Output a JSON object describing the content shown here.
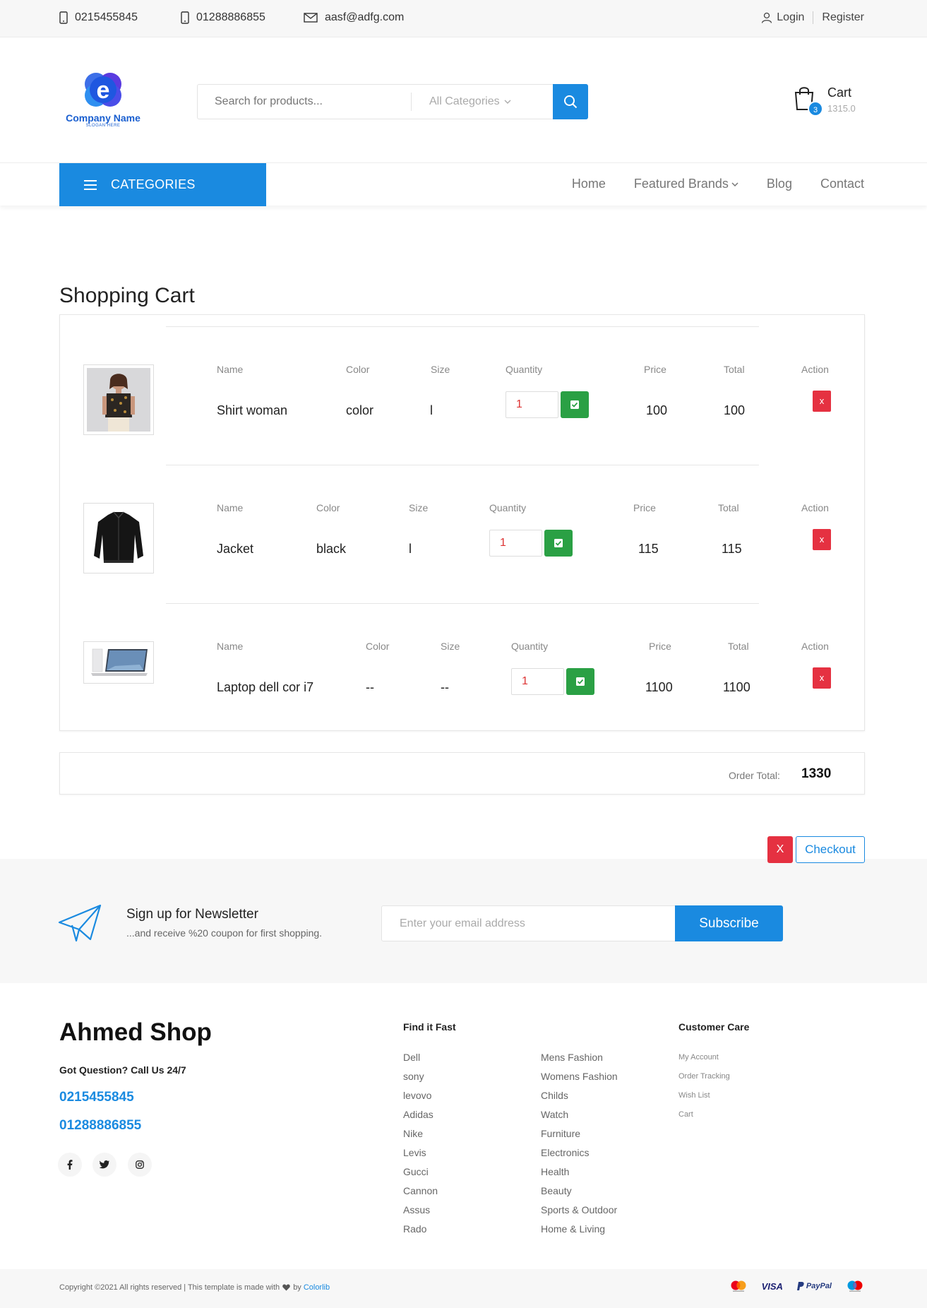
{
  "topbar": {
    "phone1": "0215455845",
    "phone2": "01288886855",
    "email": "aasf@adfg.com",
    "login": "Login",
    "register": "Register"
  },
  "header": {
    "brand_name": "Company Name",
    "slogan": "SLOGAN HERE",
    "search_placeholder": "Search for products...",
    "category_select": "All Categories",
    "cart_label": "Cart",
    "cart_amount": "1315.0",
    "cart_count": "3"
  },
  "nav": {
    "categories": "CATEGORIES",
    "links": [
      "Home",
      "Featured Brands",
      "Blog",
      "Contact"
    ]
  },
  "cart": {
    "title": "Shopping Cart",
    "headers": {
      "name": "Name",
      "color": "Color",
      "size": "Size",
      "quantity": "Quantity",
      "price": "Price",
      "total": "Total",
      "action": "Action"
    },
    "items": [
      {
        "name": "Shirt woman",
        "color": "color",
        "size": "l",
        "quantity": "1",
        "price": "100",
        "total": "100",
        "action": "x"
      },
      {
        "name": "Jacket",
        "color": "black",
        "size": "l",
        "quantity": "1",
        "price": "115",
        "total": "115",
        "action": "x"
      },
      {
        "name": "Laptop dell cor i7",
        "color": "--",
        "size": "--",
        "quantity": "1",
        "price": "1100",
        "total": "1100",
        "action": "x"
      }
    ],
    "order_total_label": "Order Total:",
    "order_total": "1330",
    "clear_label": "X",
    "checkout_label": "Checkout"
  },
  "newsletter": {
    "title": "Sign up for Newsletter",
    "subtitle": "...and receive %20 coupon for first shopping.",
    "placeholder": "Enter your email address",
    "button": "Subscribe"
  },
  "footer": {
    "shop_name": "Ahmed Shop",
    "question": "Got Question? Call Us 24/7",
    "phone1": "0215455845",
    "phone2": "01288886855",
    "find_title": "Find it Fast",
    "brands": [
      "Dell",
      "sony",
      "levovo",
      "Adidas",
      "Nike",
      "Levis",
      "Gucci",
      "Cannon",
      "Assus",
      "Rado"
    ],
    "categories": [
      "Mens Fashion",
      "Womens Fashion",
      "Childs",
      "Watch",
      "Furniture",
      "Electronics",
      "Health",
      "Beauty",
      "Sports & Outdoor",
      "Home & Living"
    ],
    "care_title": "Customer Care",
    "care_links": [
      "My Account",
      "Order Tracking",
      "Wish List",
      "Cart"
    ],
    "copyright_pre": "Copyright ©2021 All rights reserved | This template is made with",
    "copyright_by": "by",
    "copyright_brand": "Colorlib",
    "payments": [
      "VISA",
      "PayPal"
    ]
  },
  "colors": {
    "accent": "#1a8ae0",
    "danger": "#e53141",
    "success": "#2aa044"
  }
}
